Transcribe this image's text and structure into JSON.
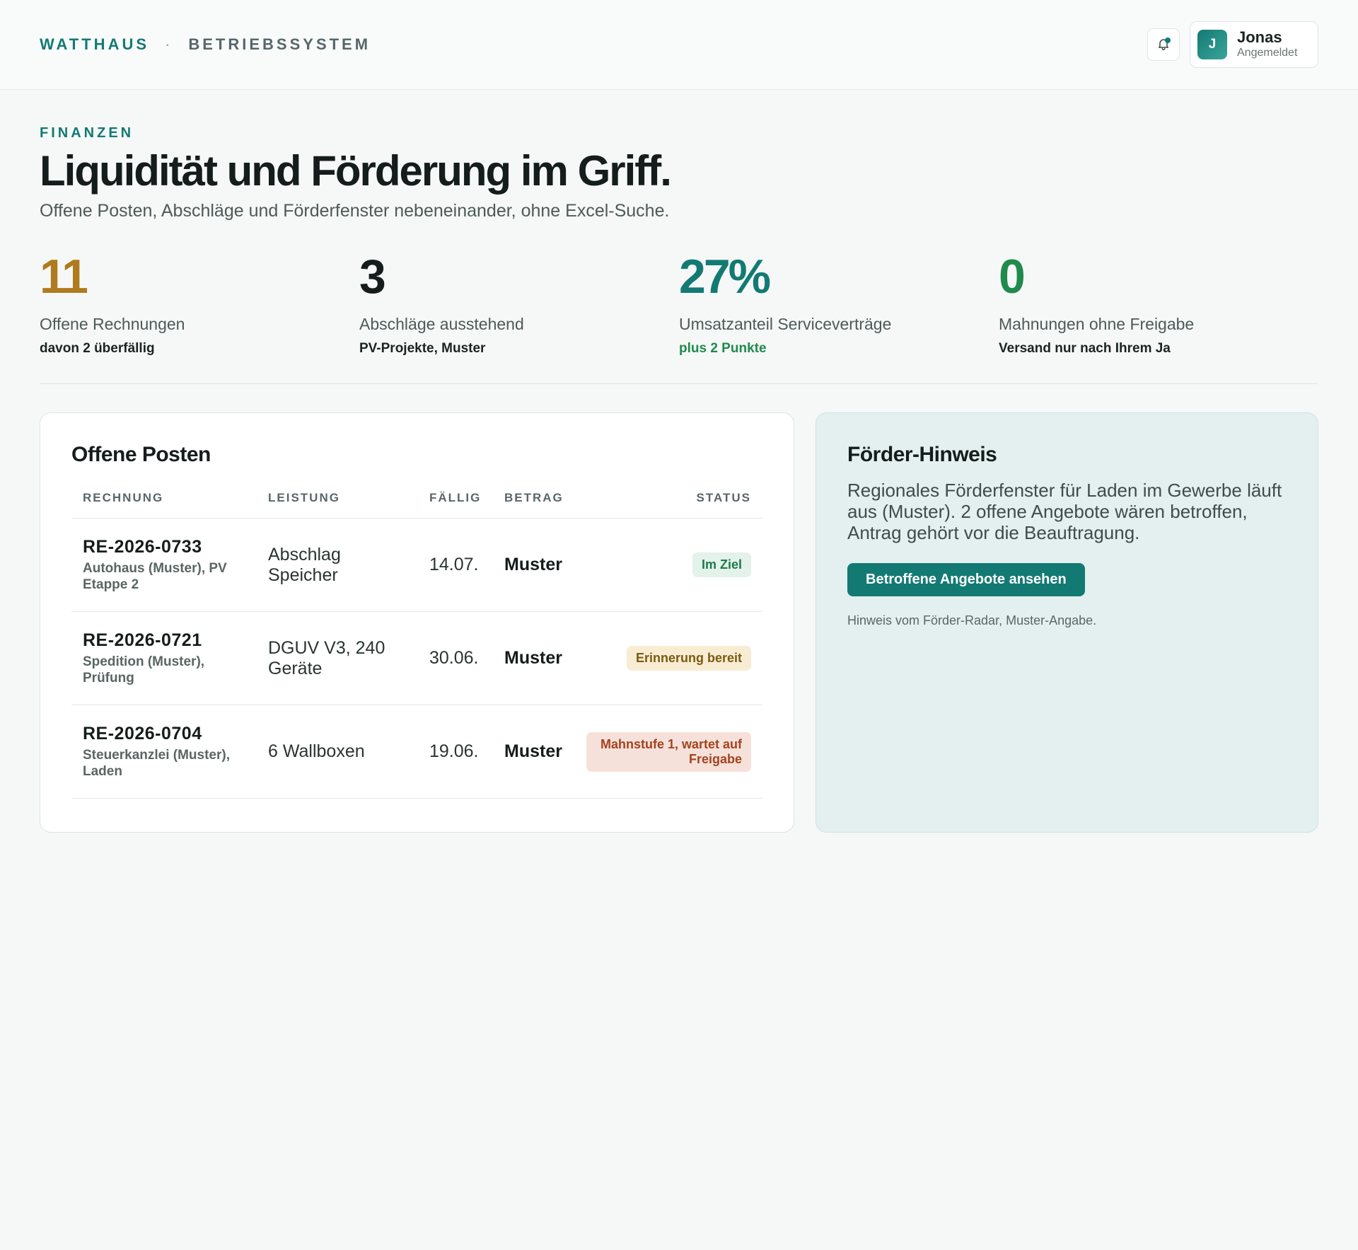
{
  "brand": {
    "name": "WATTHAUS",
    "separator": "·",
    "system": "BETRIEBSSYSTEM"
  },
  "user": {
    "initial": "J",
    "name": "Jonas",
    "status": "Angemeldet"
  },
  "icons": {
    "notifications": "bell-icon"
  },
  "page": {
    "eyebrow": "FINANZEN",
    "title": "Liquidität und Förderung im Griff.",
    "subtitle": "Offene Posten, Abschläge und Förderfenster nebeneinander, ohne Excel-Suche."
  },
  "kpis": [
    {
      "value": "11",
      "label": "Offene Rechnungen",
      "note": "davon 2 überfällig",
      "color": "#b07a1f",
      "note_color": "#1a2422"
    },
    {
      "value": "3",
      "label": "Abschläge ausstehend",
      "note": "PV-Projekte, Muster",
      "color": "#151d1c",
      "note_color": "#1a2422"
    },
    {
      "value": "27%",
      "label": "Umsatzanteil Serviceverträge",
      "note": "plus 2 Punkte",
      "color": "#137a73",
      "note_color": "#1f8a4c"
    },
    {
      "value": "0",
      "label": "Mahnungen ohne Freigabe",
      "note": "Versand nur nach Ihrem Ja",
      "color": "#1f8a4c",
      "note_color": "#1a2422"
    }
  ],
  "table": {
    "title": "Offene Posten",
    "columns": [
      "RECHNUNG",
      "LEISTUNG",
      "FÄLLIG",
      "BETRAG",
      "STATUS"
    ],
    "rows": [
      {
        "id": "RE-2026-0733",
        "client": "Autohaus (Muster), PV Etappe 2",
        "service": "Abschlag Speicher",
        "due": "14.07.",
        "amount": "Muster",
        "status": "Im Ziel",
        "status_type": "ok"
      },
      {
        "id": "RE-2026-0721",
        "client": "Spedition (Muster), Prüfung",
        "service": "DGUV V3, 240 Geräte",
        "due": "30.06.",
        "amount": "Muster",
        "status": "Erinnerung bereit",
        "status_type": "warn"
      },
      {
        "id": "RE-2026-0704",
        "client": "Steuerkanzlei (Muster), Laden",
        "service": "6 Wallboxen",
        "due": "19.06.",
        "amount": "Muster",
        "status": "Mahnstufe 1, wartet auf Freigabe",
        "status_type": "danger"
      }
    ]
  },
  "hint": {
    "title": "Förder-Hinweis",
    "body": "Regionales Förderfenster für Laden im Gewerbe läuft aus (Muster). 2 offene Angebote wären betroffen, Antrag gehört vor die Beauftragung.",
    "button": "Betroffene Angebote ansehen",
    "footnote": "Hinweis vom Förder-Radar, Muster-Angabe."
  },
  "colors": {
    "accent": "#137a73",
    "background": "#f5f8f7"
  }
}
